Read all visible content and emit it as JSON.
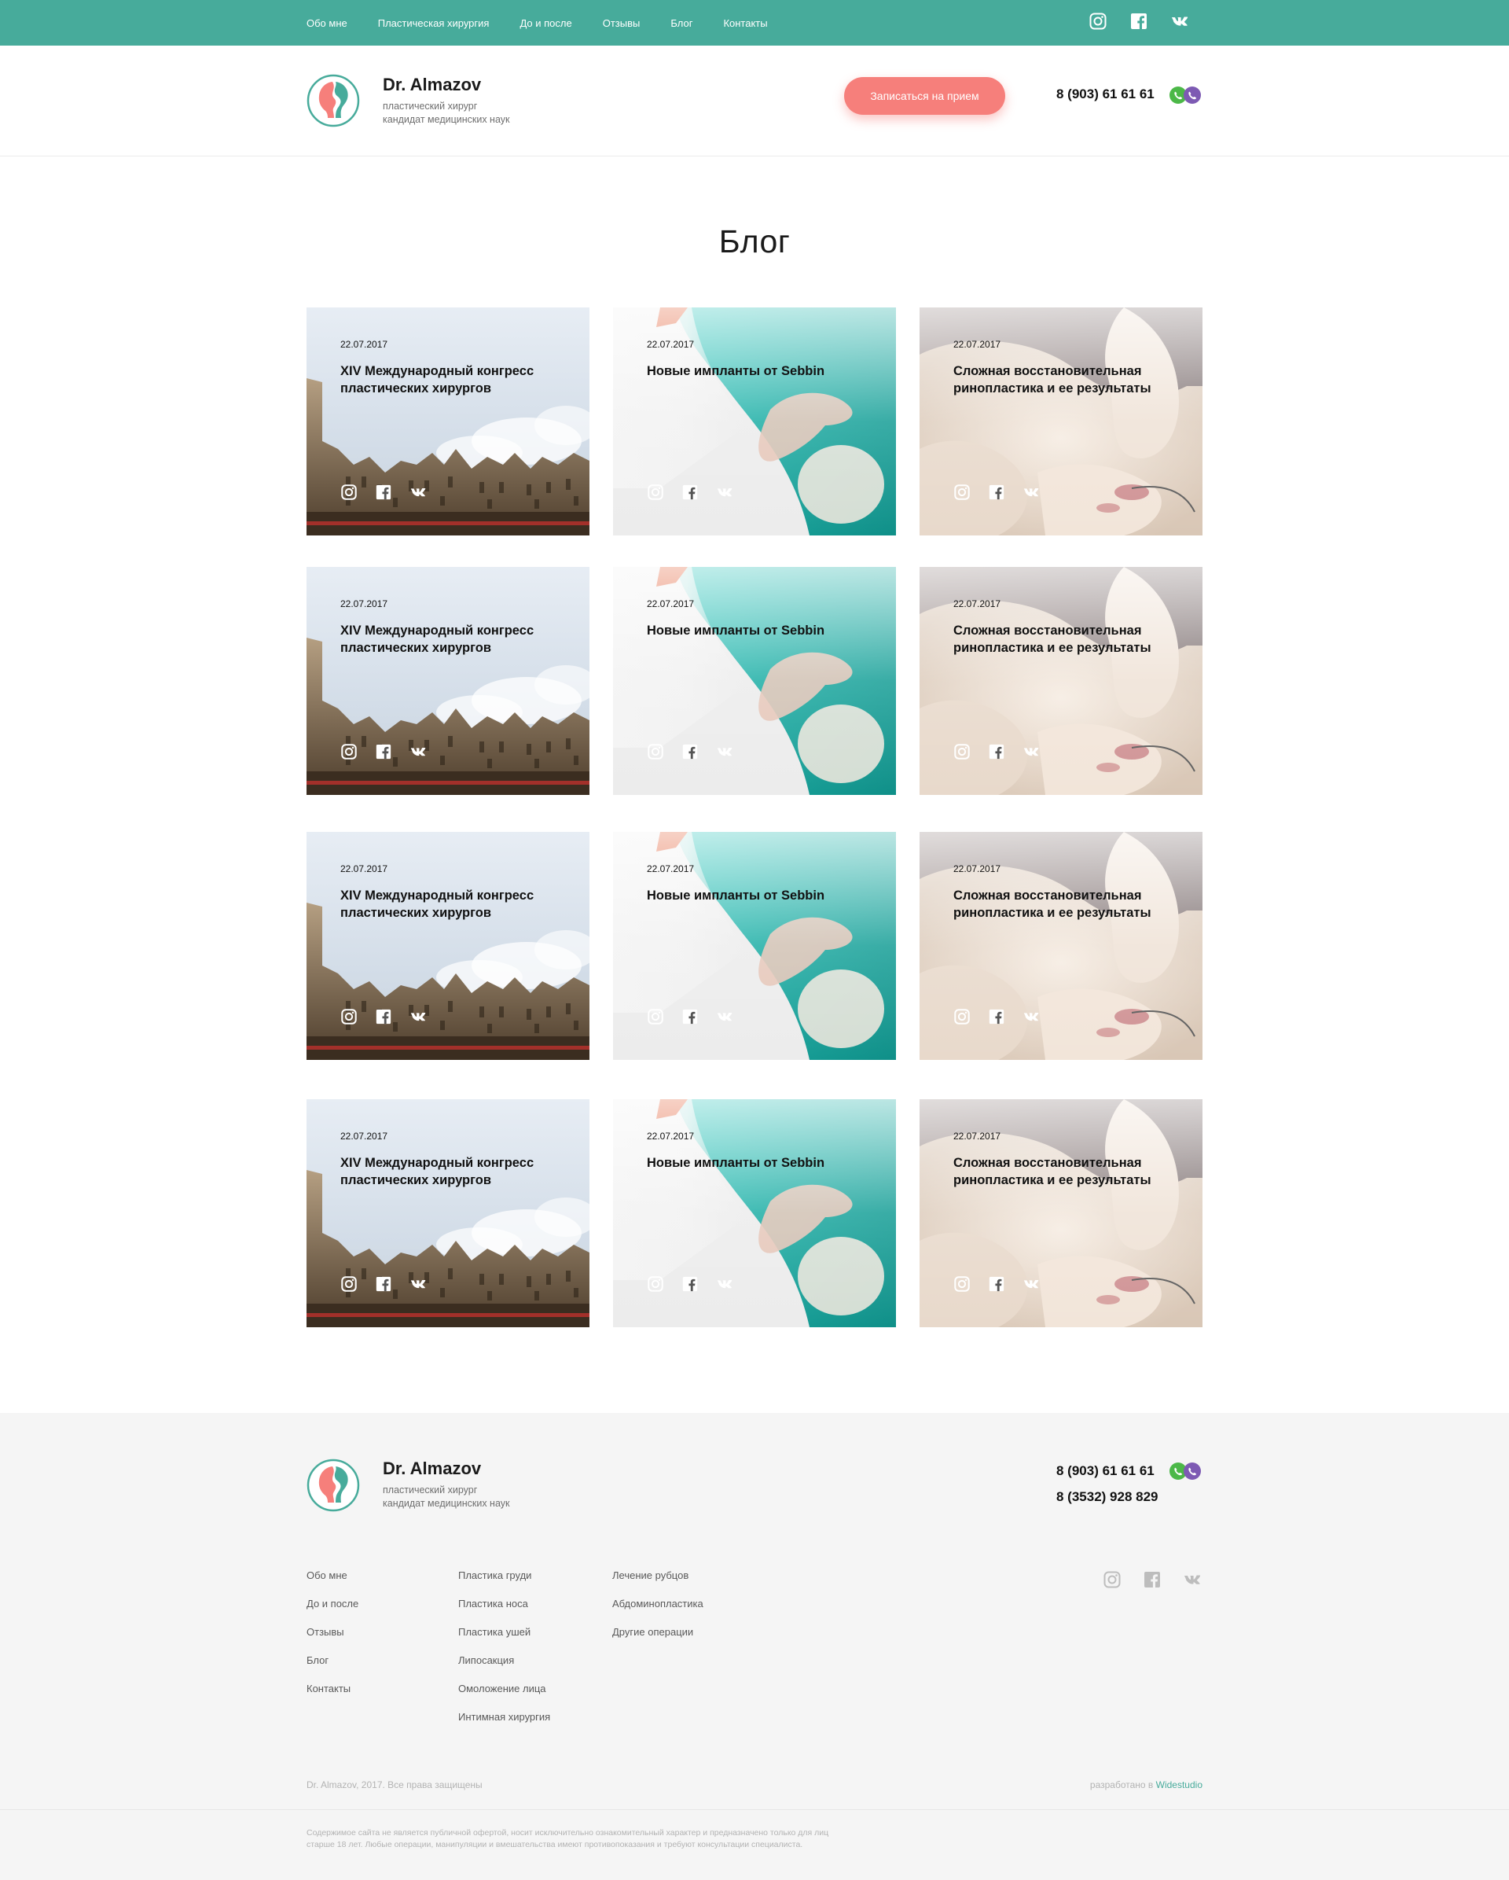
{
  "nav": {
    "items": [
      "Обо мне",
      "Пластическая хирургия",
      "До и после",
      "Отзывы",
      "Блог",
      "Контакты"
    ],
    "social_icons": [
      "instagram-icon",
      "facebook-icon",
      "vk-icon"
    ]
  },
  "header": {
    "name": "Dr. Almazov",
    "subtitle_line1": "пластический хирург",
    "subtitle_line2": "кандидат медицинских наук",
    "cta_label": "Записаться на прием",
    "phone": "8 (903) 61 61 61"
  },
  "page": {
    "title": "Блог"
  },
  "posts": [
    {
      "date": "22.07.2017",
      "title": "XIV Международный конгресс пластических хирургов",
      "image": "city-buildings"
    },
    {
      "date": "22.07.2017",
      "title": "Новые импланты от Sebbin",
      "image": "surgeon-implant"
    },
    {
      "date": "22.07.2017",
      "title": "Сложная восстановительная ринопластика и ее результаты",
      "image": "gloved-hands"
    },
    {
      "date": "22.07.2017",
      "title": "XIV Международный конгресс пластических хирургов",
      "image": "city-buildings"
    },
    {
      "date": "22.07.2017",
      "title": "Новые импланты от Sebbin",
      "image": "surgeon-implant"
    },
    {
      "date": "22.07.2017",
      "title": "Сложная восстановительная ринопластика и ее результаты",
      "image": "gloved-hands"
    },
    {
      "date": "22.07.2017",
      "title": "XIV Международный конгресс пластических хирургов",
      "image": "city-buildings"
    },
    {
      "date": "22.07.2017",
      "title": "Новые импланты от Sebbin",
      "image": "surgeon-implant"
    },
    {
      "date": "22.07.2017",
      "title": "Сложная восстановительная ринопластика и ее результаты",
      "image": "gloved-hands"
    },
    {
      "date": "22.07.2017",
      "title": "XIV Международный конгресс пластических хирургов",
      "image": "city-buildings"
    },
    {
      "date": "22.07.2017",
      "title": "Новые импланты от Sebbin",
      "image": "surgeon-implant"
    },
    {
      "date": "22.07.2017",
      "title": "Сложная восстановительная ринопластика и ее результаты",
      "image": "gloved-hands"
    }
  ],
  "footer": {
    "name": "Dr. Almazov",
    "subtitle_line1": "пластический хирург",
    "subtitle_line2": "кандидат медицинских наук",
    "phone1": "8 (903) 61 61 61",
    "phone2": "8 (3532) 928 829",
    "col1": [
      "Обо мне",
      "До и после",
      "Отзывы",
      "Блог",
      "Контакты"
    ],
    "col2": [
      "Пластика груди",
      "Пластика носа",
      "Пластика ушей",
      "Липосакция",
      "Омоложение лица",
      "Интимная хирургия"
    ],
    "col3": [
      "Лечение рубцов",
      "Абдоминопластика",
      "Другие операции"
    ],
    "copyright": "Dr. Almazov, 2017. Все права защищены",
    "dev_prefix": "разработано в",
    "dev_name": "Widestudio",
    "disclaimer": "Содержимое сайта не является публичной офертой, носит исключительно ознакомительный характер и предназначено только для лиц старше 18 лет. Любые операции, манипуляции и вмешательства имеют противопоказания и требуют консультации специалиста."
  },
  "colors": {
    "accent": "#47ab9b",
    "cta": "#f67f7b",
    "footer_bg": "#f5f5f5",
    "whatsapp": "#4cb848",
    "viber": "#7d5ab3"
  }
}
